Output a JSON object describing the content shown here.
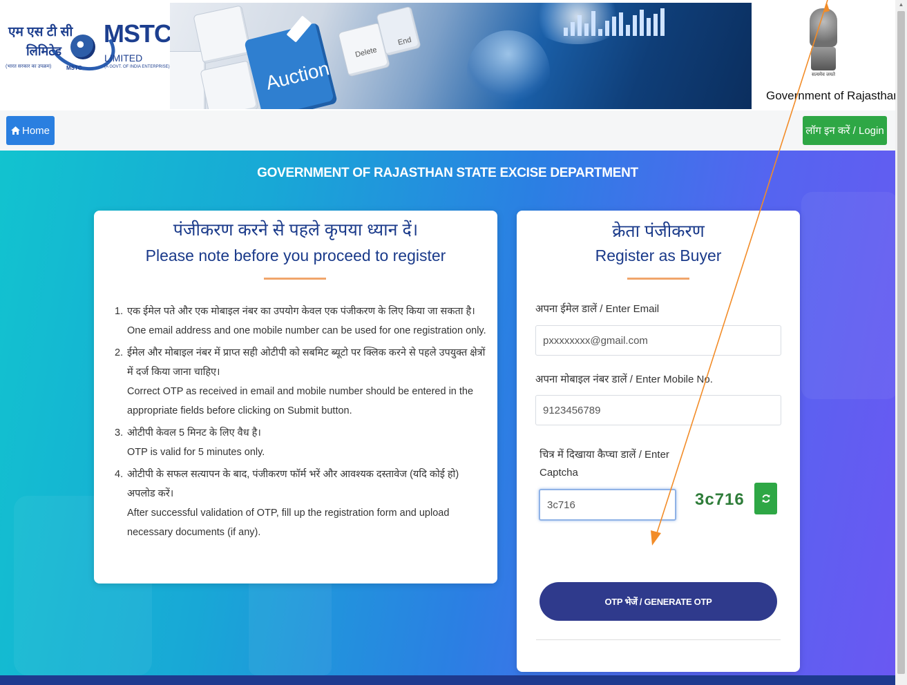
{
  "header": {
    "logo": {
      "hindi_line1": "एम एस टी सी",
      "hindi_line2": "लिमिटेड",
      "hindi_line3": "(भारत सरकार का उपक्रम)",
      "mstc_small": "MSTC",
      "brand": "MSTC",
      "limited": "LIMITED",
      "subtitle": "(A GOVT. OF INDIA ENTERPRISE)"
    },
    "banner": {
      "auction_key": "Auction",
      "key_delete": "Delete",
      "key_end": "End"
    },
    "emblem_motto": "सत्यमेव जयते",
    "government_label": "Government of Rajasthan"
  },
  "nav": {
    "home_icon": "home-icon",
    "home_label": "Home",
    "login_label": "लॉग इन करें / Login"
  },
  "hero": {
    "department_title": "GOVERNMENT OF RAJASTHAN STATE EXCISE DEPARTMENT"
  },
  "notice": {
    "title_hi": "पंजीकरण करने से पहले कृपया ध्यान दें।",
    "title_en": "Please note before you proceed to register",
    "items": [
      {
        "num": "1.",
        "hi": "एक ईमेल पते और एक मोबाइल नंबर का उपयोग केवल एक पंजीकरण के लिए किया जा सकता है।",
        "en": "One email address and one mobile number can be used for one registration only."
      },
      {
        "num": "2.",
        "hi": "ईमेल और मोबाइल नंबर में प्राप्त सही ओटीपी को सबमिट ब्यूटो पर क्लिक करने से पहले उपयुक्त क्षेत्रों में दर्ज किया जाना चाहिए।",
        "en": "Correct OTP as received in email and mobile number should be entered in the appropriate fields before clicking on Submit button."
      },
      {
        "num": "3.",
        "hi": "ओटीपी केवल 5 मिनट के लिए वैध है।",
        "en": "OTP is valid for 5 minutes only."
      },
      {
        "num": "4.",
        "hi": "ओटीपी के सफल सत्यापन के बाद, पंजीकरण फॉर्म भरें और आवश्यक दस्तावेज (यदि कोई हो) अपलोड करें।",
        "en": "After successful validation of OTP, fill up the registration form and upload necessary documents (if any)."
      }
    ]
  },
  "register": {
    "title_hi": "क्रेता पंजीकरण",
    "title_en": "Register as Buyer",
    "email_label": "अपना ईमेल डालें / Enter Email",
    "email_value": "pxxxxxxxx@gmail.com",
    "mobile_label": "अपना मोबाइल नंबर डालें / Enter Mobile No.",
    "mobile_value": "9123456789",
    "captcha_label_line1": "चित्र में दिखाया कैप्चा डालें / Enter",
    "captcha_label_line2": "Captcha",
    "captcha_value": "3c716",
    "captcha_image_text": "3c716",
    "refresh_icon": "refresh-icon",
    "otp_button": "OTP भेजें / GENERATE OTP"
  },
  "colors": {
    "primary_blue": "#2a7fe0",
    "success_green": "#2ea745",
    "navy": "#2f3a8c",
    "annotation_arrow": "#f28c28"
  }
}
